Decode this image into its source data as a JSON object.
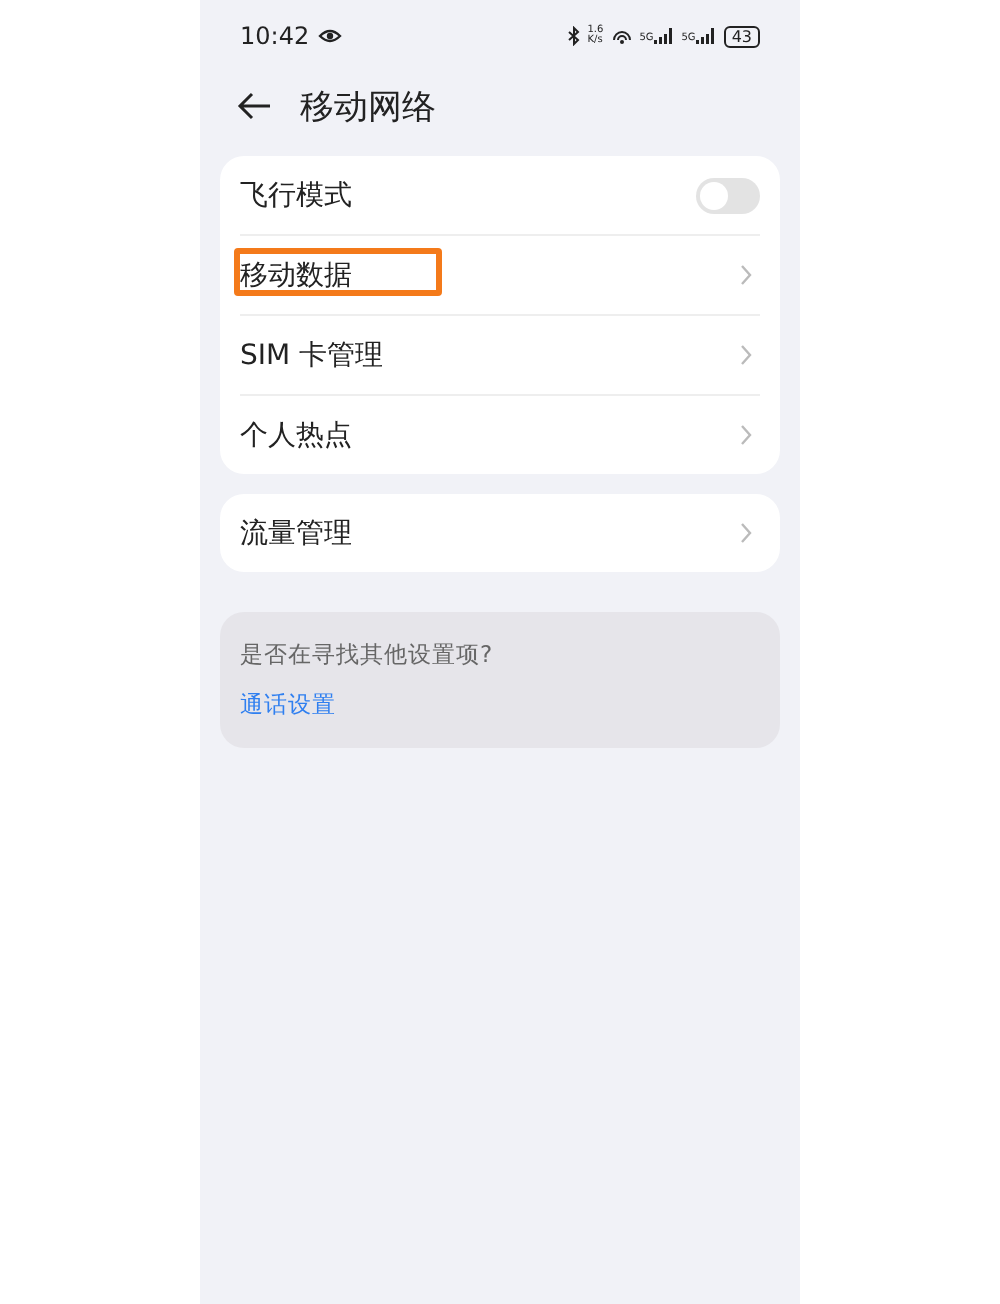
{
  "status_bar": {
    "time": "10:42",
    "speed_value": "1.6",
    "speed_unit": "K/s",
    "sim_labels": [
      "5G",
      "5G"
    ],
    "battery": "43"
  },
  "header": {
    "title": "移动网络"
  },
  "groups": [
    {
      "items": [
        {
          "label": "飞行模式",
          "kind": "toggle",
          "on": false,
          "highlighted": false
        },
        {
          "label": "移动数据",
          "kind": "link",
          "highlighted": true
        },
        {
          "label": "SIM 卡管理",
          "kind": "link",
          "highlighted": false
        },
        {
          "label": "个人热点",
          "kind": "link",
          "highlighted": false
        }
      ]
    },
    {
      "items": [
        {
          "label": "流量管理",
          "kind": "link",
          "highlighted": false
        }
      ]
    }
  ],
  "suggestion": {
    "question": "是否在寻找其他设置项?",
    "link": "通话设置"
  }
}
